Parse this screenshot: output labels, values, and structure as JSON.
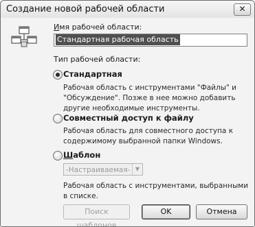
{
  "window": {
    "title": "Создание новой рабочей области",
    "close_glyph": "✕"
  },
  "name": {
    "label_prefix": "И",
    "label_rest": "мя рабочей области:",
    "value": "Стандартная рабочая область"
  },
  "type": {
    "label": "Тип рабочей области:",
    "options": [
      {
        "label": "Стандартная",
        "checked": true,
        "desc": "Рабочая область с инструментами \"Файлы\" и \"Обсуждение\". Позже в нее можно добавить другие необходимые инструменты."
      },
      {
        "label": "Совместный доступ к файлу",
        "checked": false,
        "desc": "Рабочая область для совместного доступа к содержимому выбранной папки Windows."
      },
      {
        "label_prefix": "Ш",
        "label_rest": "аблон",
        "checked": false,
        "desc": "Рабочая область с инструментами, выбранными в списке."
      }
    ],
    "template_select": "-Настраиваемая-"
  },
  "buttons": {
    "browse": "Поиск шаблонов",
    "ok": "OK",
    "cancel": "Отмена"
  }
}
